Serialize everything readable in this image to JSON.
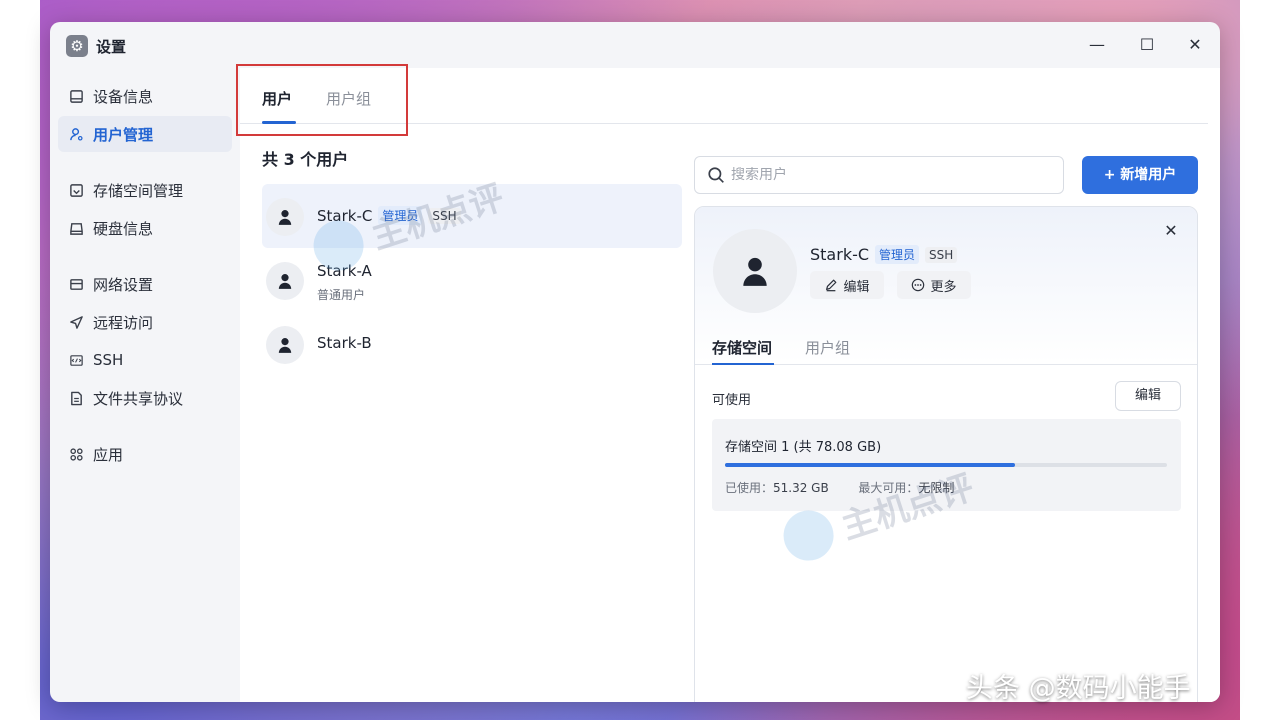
{
  "window": {
    "title": "设置",
    "minimize": "—",
    "maximize": "☐",
    "close": "✕"
  },
  "sidebar": {
    "items": [
      {
        "label": "设备信息",
        "icon": "device-icon",
        "active": false
      },
      {
        "label": "用户管理",
        "icon": "user-icon",
        "active": true
      },
      {
        "label": "存储空间管理",
        "icon": "storage-icon",
        "active": false
      },
      {
        "label": "硬盘信息",
        "icon": "disk-icon",
        "active": false
      },
      {
        "label": "网络设置",
        "icon": "network-icon",
        "active": false
      },
      {
        "label": "远程访问",
        "icon": "remote-icon",
        "active": false
      },
      {
        "label": "SSH",
        "icon": "ssh-icon",
        "active": false
      },
      {
        "label": "文件共享协议",
        "icon": "file-share-icon",
        "active": false
      },
      {
        "label": "应用",
        "icon": "apps-icon",
        "active": false
      }
    ]
  },
  "tabs": [
    {
      "label": "用户",
      "active": true
    },
    {
      "label": "用户组",
      "active": false
    }
  ],
  "user_list": {
    "count_title": "共 3 个用户",
    "users": [
      {
        "name": "Stark-C",
        "badges": [
          "管理员",
          "SSH"
        ],
        "subtitle": "",
        "selected": true
      },
      {
        "name": "Stark-A",
        "badges": [],
        "subtitle": "普通用户",
        "selected": false
      },
      {
        "name": "Stark-B",
        "badges": [],
        "subtitle": "",
        "selected": false
      }
    ]
  },
  "search": {
    "placeholder": "搜索用户"
  },
  "add_user_button": "+ 新增用户",
  "detail": {
    "name": "Stark-C",
    "badges": [
      "管理员",
      "SSH"
    ],
    "edit_label": "编辑",
    "more_label": "更多",
    "close": "✕",
    "tabs": [
      {
        "label": "存储空间",
        "active": true
      },
      {
        "label": "用户组",
        "active": false
      }
    ],
    "available_label": "可使用",
    "available_edit": "编辑",
    "storage": {
      "title": "存储空间 1 (共 78.08 GB)",
      "used_label": "已使用：",
      "used_value": "51.32 GB",
      "max_label": "最大可用：",
      "max_value": "无限制",
      "usage_fraction": 0.657
    }
  },
  "watermark": {
    "text": "主机点评"
  },
  "credit": "头条 @数码小能手",
  "colors": {
    "accent": "#2364d2",
    "button": "#2f6fde",
    "highlight_box": "#d33a3a"
  }
}
